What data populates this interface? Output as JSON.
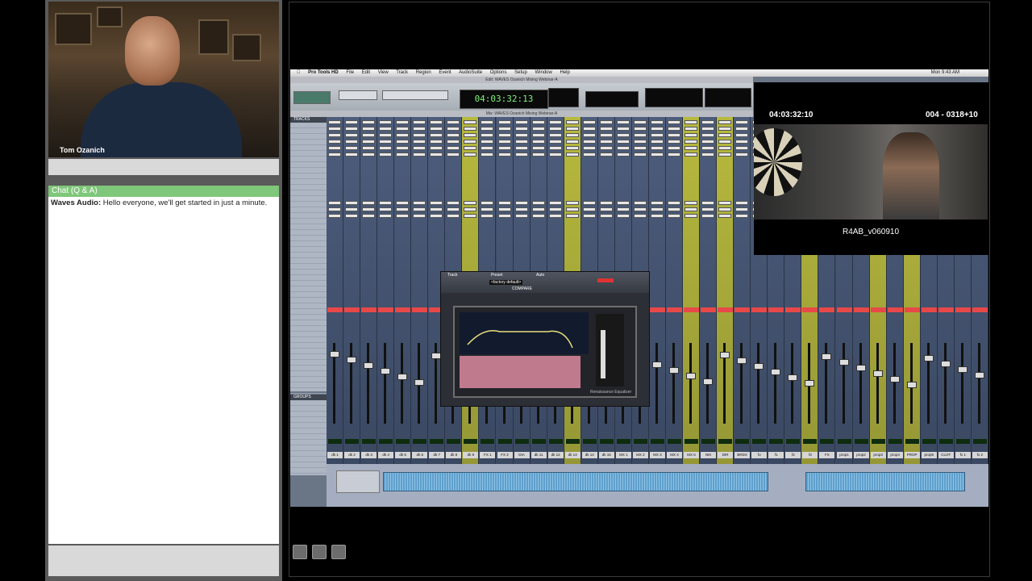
{
  "webcam": {
    "name": "Tom Ozanich"
  },
  "chat": {
    "header": "Chat (Q & A)",
    "messages": [
      {
        "author": "Waves Audio:",
        "text": "Hello everyone, we'll get started in just a minute."
      }
    ]
  },
  "protools": {
    "menubar": {
      "app": "Pro Tools HD",
      "items": [
        "File",
        "Edit",
        "View",
        "Track",
        "Region",
        "Event",
        "AudioSuite",
        "Options",
        "Setup",
        "Window",
        "Help"
      ],
      "clock": "Mon 9:43 AM"
    },
    "edit_window_title": "Edit: WAVES Ozanich Mixing Webinar-A",
    "mix_window_title": "Mix: WAVES Ozanich Mixing Webinar-A",
    "main_counter": "04:03:32:13",
    "tracks_header": "TRACKS",
    "groups_header": "GROUPS",
    "strip_names": [
      "dk 1",
      "dk 2",
      "dk 3",
      "dk 4",
      "dk 5",
      "dk 6",
      "dk 7",
      "dk 8",
      "dk 9",
      "FX 1",
      "FX 2",
      "DIA",
      "dk 11",
      "dk 12",
      "dk 13",
      "dk 14",
      "dk 15",
      "MX 1",
      "MX 2",
      "MX 3",
      "MX 4",
      "MX 5",
      "NIK",
      "DIR",
      "BRDX",
      "fo",
      "f1",
      "f2",
      "f3",
      "FX",
      "prop1",
      "prop2",
      "prop3",
      "prop4",
      "PROP",
      "prop5",
      "CLOT",
      "fx 1",
      "fx 2"
    ],
    "plugin": {
      "track": "Track",
      "preset": "Preset",
      "auto": "Auto",
      "setting": "<factory default>",
      "compare": "COMPARE",
      "brand": "Renaissance Equalizer"
    }
  },
  "video": {
    "timecode": "04:03:32:10",
    "feet": "004 - 0318+10",
    "caption": "R4AB_v060910"
  }
}
